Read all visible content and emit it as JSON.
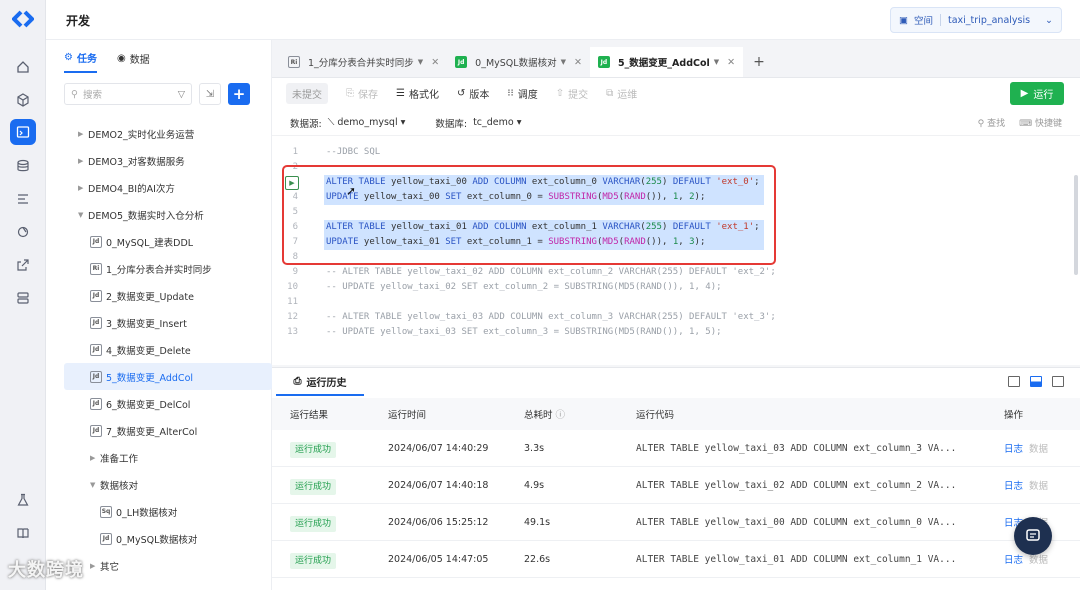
{
  "app": {
    "title": "开发"
  },
  "workspace": {
    "label": "空间",
    "name": "taxi_trip_analysis"
  },
  "sidebar": {
    "tabs": [
      {
        "label": "任务"
      },
      {
        "label": "数据"
      }
    ],
    "search_placeholder": "搜索",
    "tree": [
      {
        "label": "DEMO2_实时化业务运营",
        "type": "folder"
      },
      {
        "label": "DEMO3_对客数据服务",
        "type": "folder"
      },
      {
        "label": "DEMO4_BI的AI次方",
        "type": "folder"
      },
      {
        "label": "DEMO5_数据实时入仓分析",
        "type": "folder-open"
      },
      {
        "label": "0_MySQL_建表DDL",
        "type": "file",
        "icon": "Jd"
      },
      {
        "label": "1_分库分表合并实时同步",
        "type": "file",
        "icon": "Ri"
      },
      {
        "label": "2_数据变更_Update",
        "type": "file",
        "icon": "Jd"
      },
      {
        "label": "3_数据变更_Insert",
        "type": "file",
        "icon": "Jd"
      },
      {
        "label": "4_数据变更_Delete",
        "type": "file",
        "icon": "Jd"
      },
      {
        "label": "5_数据变更_AddCol",
        "type": "file",
        "icon": "Jd",
        "selected": true
      },
      {
        "label": "6_数据变更_DelCol",
        "type": "file",
        "icon": "Jd"
      },
      {
        "label": "7_数据变更_AlterCol",
        "type": "file",
        "icon": "Jd"
      },
      {
        "label": "准备工作",
        "type": "subfolder"
      },
      {
        "label": "数据核对",
        "type": "subfolder-open"
      },
      {
        "label": "0_LH数据核对",
        "type": "subfile",
        "icon": "Sq"
      },
      {
        "label": "0_MySQL数据核对",
        "type": "subfile",
        "icon": "Jd"
      },
      {
        "label": "其它",
        "type": "subfolder"
      }
    ]
  },
  "editor_tabs": [
    {
      "icon": "Ri",
      "label": "1_分库分表合并实时同步",
      "active": false
    },
    {
      "icon": "Jd",
      "label": "0_MySQL数据核对",
      "active": false
    },
    {
      "icon": "Jd",
      "label": "5_数据变更_AddCol",
      "active": true
    }
  ],
  "toolbar": {
    "uncommitted": "未提交",
    "save": "保存",
    "format": "格式化",
    "version": "版本",
    "schedule": "调度",
    "submit": "提交",
    "ops": "运维",
    "run": "运行"
  },
  "datasource": {
    "ds_label": "数据源:",
    "ds_value": "demo_mysql",
    "db_label": "数据库:",
    "db_value": "tc_demo",
    "find": "查找",
    "shortcut": "快捷键"
  },
  "code_lines": [
    {
      "n": "1",
      "text": "--JDBC SQL"
    },
    {
      "n": "2",
      "text": ""
    },
    {
      "n": "3",
      "text": "ALTER TABLE yellow_taxi_00 ADD COLUMN ext_column_0 VARCHAR(255) DEFAULT 'ext_0';"
    },
    {
      "n": "4",
      "text": "UPDATE yellow_taxi_00 SET ext_column_0 = SUBSTRING(MD5(RAND()), 1, 2);"
    },
    {
      "n": "5",
      "text": ""
    },
    {
      "n": "6",
      "text": "ALTER TABLE yellow_taxi_01 ADD COLUMN ext_column_1 VARCHAR(255) DEFAULT 'ext_1';"
    },
    {
      "n": "7",
      "text": "UPDATE yellow_taxi_01 SET ext_column_1 = SUBSTRING(MD5(RAND()), 1, 3);"
    },
    {
      "n": "8",
      "text": ""
    },
    {
      "n": "9",
      "text": "-- ALTER TABLE yellow_taxi_02 ADD COLUMN ext_column_2 VARCHAR(255) DEFAULT 'ext_2';"
    },
    {
      "n": "10",
      "text": "-- UPDATE yellow_taxi_02 SET ext_column_2 = SUBSTRING(MD5(RAND()), 1, 4);"
    },
    {
      "n": "11",
      "text": ""
    },
    {
      "n": "12",
      "text": "-- ALTER TABLE yellow_taxi_03 ADD COLUMN ext_column_3 VARCHAR(255) DEFAULT 'ext_3';"
    },
    {
      "n": "13",
      "text": "-- UPDATE yellow_taxi_03 SET ext_column_3 = SUBSTRING(MD5(RAND()), 1, 5);"
    }
  ],
  "history": {
    "tab": "运行历史",
    "headers": {
      "result": "运行结果",
      "time": "运行时间",
      "duration": "总耗时",
      "code": "运行代码",
      "ops": "操作"
    },
    "rows": [
      {
        "result": "运行成功",
        "time": "2024/06/07 14:40:29",
        "duration": "3.3s",
        "code": "ALTER TABLE yellow_taxi_03 ADD COLUMN ext_column_3 VA...",
        "log": "日志",
        "data": "数据"
      },
      {
        "result": "运行成功",
        "time": "2024/06/07 14:40:18",
        "duration": "4.9s",
        "code": "ALTER TABLE yellow_taxi_02 ADD COLUMN ext_column_2 VA...",
        "log": "日志",
        "data": "数据"
      },
      {
        "result": "运行成功",
        "time": "2024/06/06 15:25:12",
        "duration": "49.1s",
        "code": "ALTER TABLE yellow_taxi_00 ADD COLUMN ext_column_0 VA...",
        "log": "日志",
        "data": "数据"
      },
      {
        "result": "运行成功",
        "time": "2024/06/05 14:47:05",
        "duration": "22.6s",
        "code": "ALTER TABLE yellow_taxi_01 ADD COLUMN ext_column_1 VA...",
        "log": "日志",
        "data": "数据"
      }
    ]
  },
  "watermark": "大数跨境",
  "colors": {
    "accent": "#1a6cf0",
    "run": "#1fb150",
    "highlight_box": "#e53935"
  }
}
